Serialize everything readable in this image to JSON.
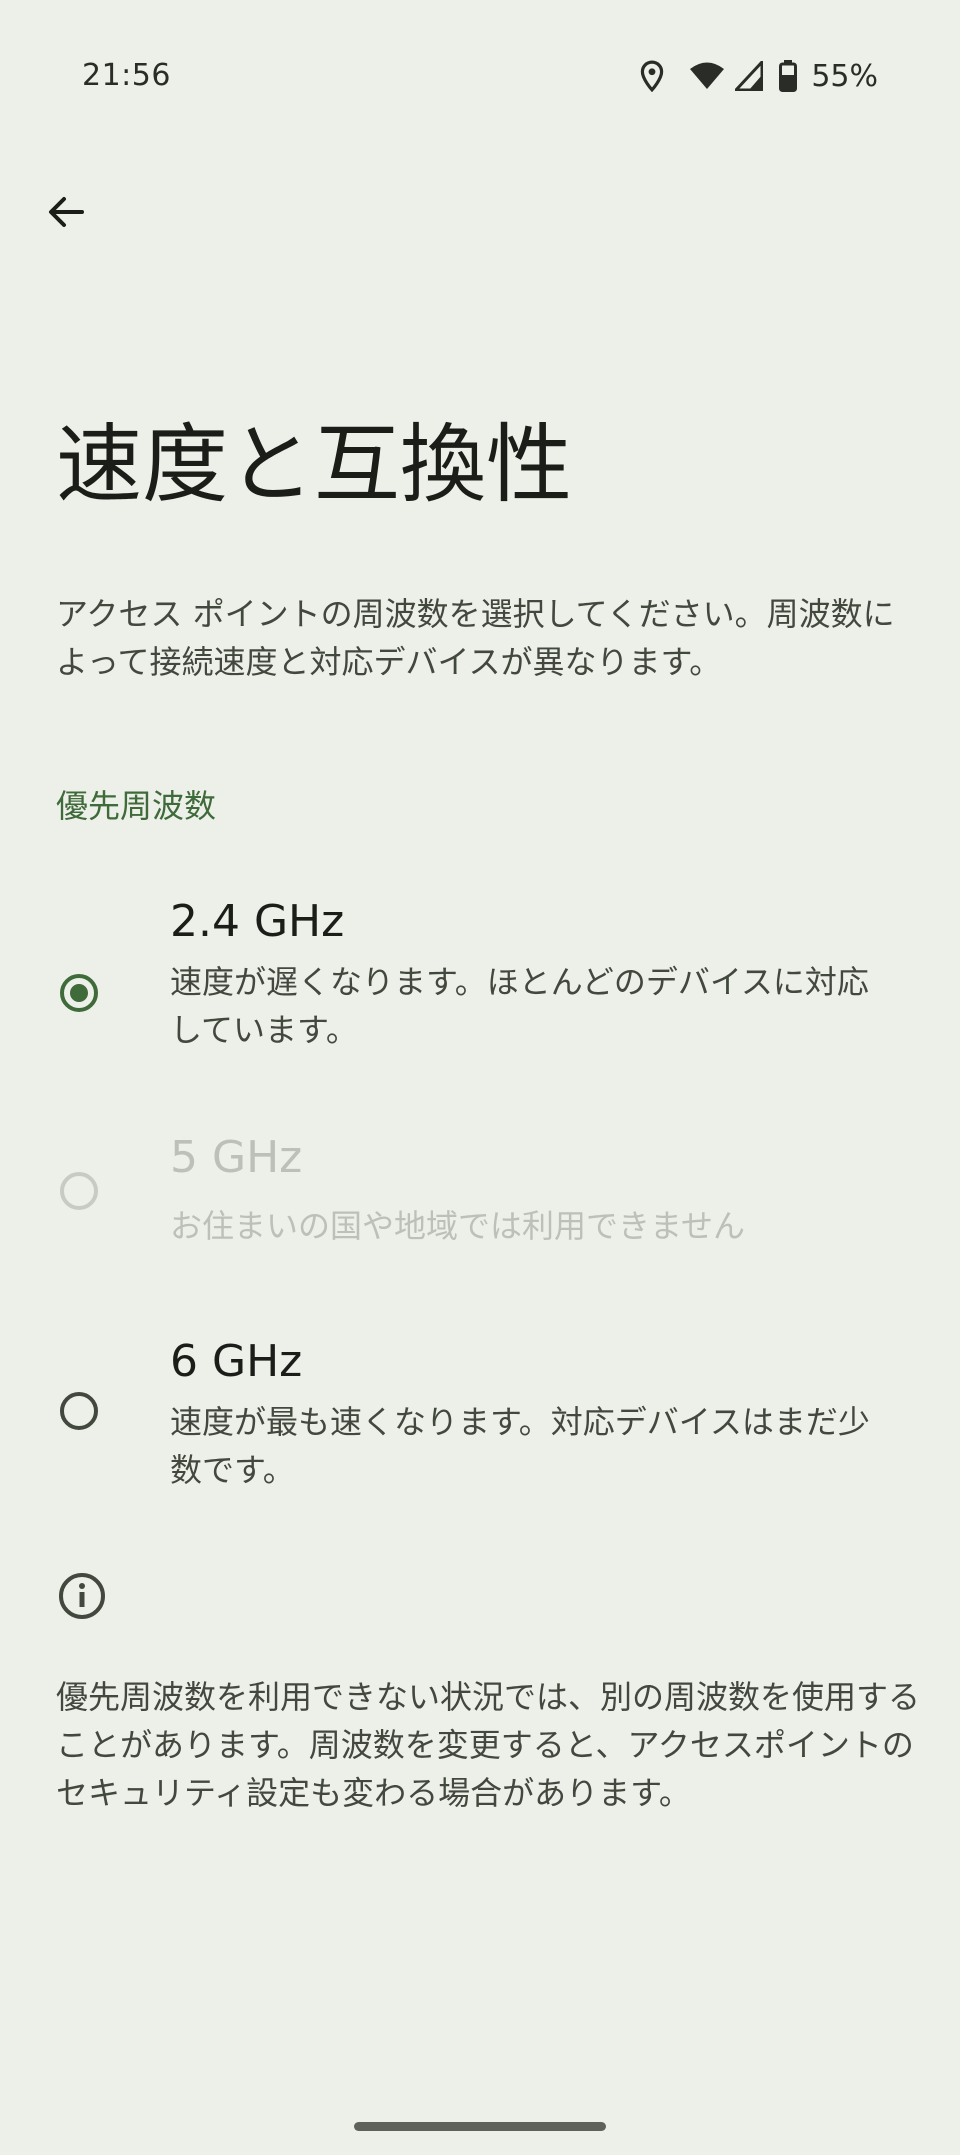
{
  "status_bar": {
    "time": "21:56",
    "battery_percent": "55%",
    "icons": [
      "location-icon",
      "wifi-icon",
      "cell-signal-icon",
      "battery-icon"
    ]
  },
  "header": {
    "back_icon": "arrow-back-icon",
    "title": "速度と互換性"
  },
  "description": "アクセス ポイントの周波数を選択してください。周波数によって接続速度と対応デバイスが異なります。",
  "section": {
    "title": "優先周波数"
  },
  "options": [
    {
      "title": "2.4 GHz",
      "summary": "速度が遅くなります。ほとんどのデバイスに対応しています。",
      "selected": true,
      "enabled": true
    },
    {
      "title": "5 GHz",
      "summary": "お住まいの国や地域では利用できません",
      "selected": false,
      "enabled": false
    },
    {
      "title": "6 GHz",
      "summary": "速度が最も速くなります。対応デバイスはまだ少数です。",
      "selected": false,
      "enabled": true
    }
  ],
  "footer": {
    "icon": "info-icon",
    "text": "優先周波数を利用できない状況では、別の周波数を使用することがあります。周波数を変更すると、アクセスポイントのセキュリティ設定も変わる場合があります。"
  },
  "colors": {
    "background": "#EDF0E8",
    "accent": "#3F6A3A",
    "text_primary": "#1B1D19",
    "text_secondary": "#43483F",
    "disabled": "#BDC0B8"
  }
}
